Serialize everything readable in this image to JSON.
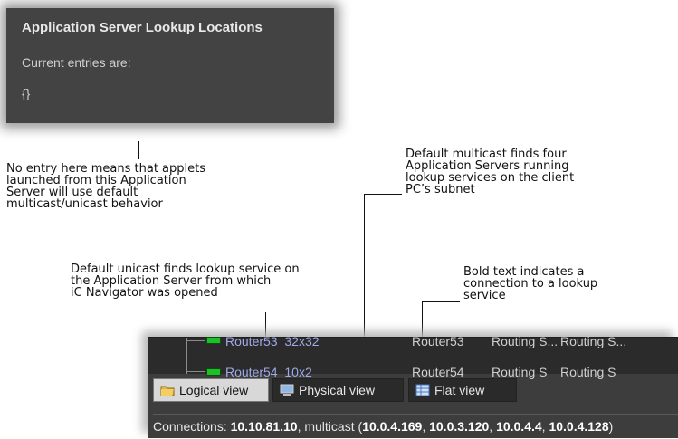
{
  "panel": {
    "title": "Application Server Lookup Locations",
    "line": "Current entries are:",
    "value": "{}"
  },
  "annotations": {
    "no_entry": "No entry here means that applets\nlaunched from this Application\nServer will use default\nmulticast/unicast behavior",
    "multicast": "Default multicast finds four\nApplication Servers running\nlookup services on the client\nPC’s subnet",
    "unicast": "Default unicast finds lookup service on\nthe Application Server from which\niC Navigator was opened",
    "bold": "Bold text indicates a\nconnection to a lookup\nservice"
  },
  "tree": {
    "rows": [
      {
        "name": "Router53_32x32",
        "col2": "Router53",
        "col3": "Routing S...",
        "col4": "Routing S..."
      },
      {
        "name": "Router54_10x2",
        "col2": "Router54",
        "col3": "Routing S",
        "col4": "Routing S"
      }
    ]
  },
  "tabs": [
    {
      "label": "Logical view",
      "icon": "folder-icon",
      "active": true
    },
    {
      "label": "Physical view",
      "icon": "computer-icon",
      "active": false
    },
    {
      "label": "Flat view",
      "icon": "table-icon",
      "active": false
    }
  ],
  "status": {
    "prefix": "Connections: ",
    "unicast_server": "10.10.81.10",
    "sep1": ", multicast (",
    "servers": [
      "10.0.4.169",
      "10.0.3.120",
      "10.0.4.4",
      "10.0.4.128"
    ],
    "comma": ", ",
    "close": ")"
  }
}
